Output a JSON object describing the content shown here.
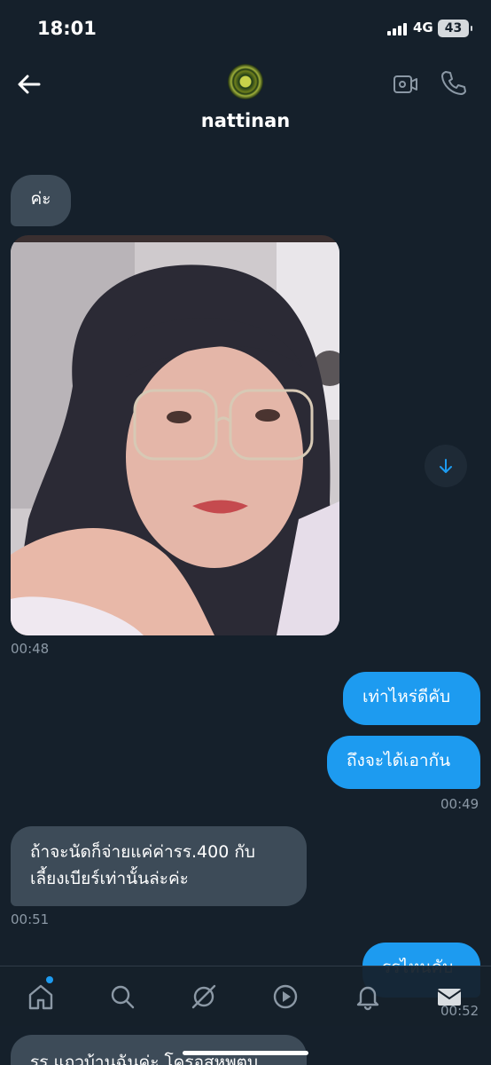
{
  "status": {
    "time": "18:01",
    "network": "4G",
    "battery": "43"
  },
  "header": {
    "name": "nattinan"
  },
  "messages": [
    {
      "dir": "in",
      "text": "ค่ะ"
    },
    {
      "dir": "in",
      "type": "photo",
      "time": "00:48"
    },
    {
      "dir": "out",
      "text": "เท่าไหร่ดีคับ"
    },
    {
      "dir": "out",
      "text": "ถึงจะได้เอากัน",
      "time": "00:49"
    },
    {
      "dir": "in",
      "line1": "ถ้าจะนัดก็จ่ายแค่ค่ารร.400 กับ",
      "line2": "เลี้ยงเบียร์เท่านั้นล่ะค่ะ",
      "time": "00:51"
    },
    {
      "dir": "out",
      "text": "รรไหนคับ",
      "time": "00:52"
    },
    {
      "dir": "in",
      "text": "รร.แถวบ้านฉันค่ะ โครอสหพตบ"
    }
  ],
  "nav": {
    "items": [
      "home-icon",
      "search-icon",
      "spaces-icon",
      "video-icon",
      "notifications-icon",
      "messages-icon"
    ]
  },
  "colors": {
    "background": "#15202b",
    "accent": "#1d9bf0",
    "incoming": "#3d4b58"
  }
}
